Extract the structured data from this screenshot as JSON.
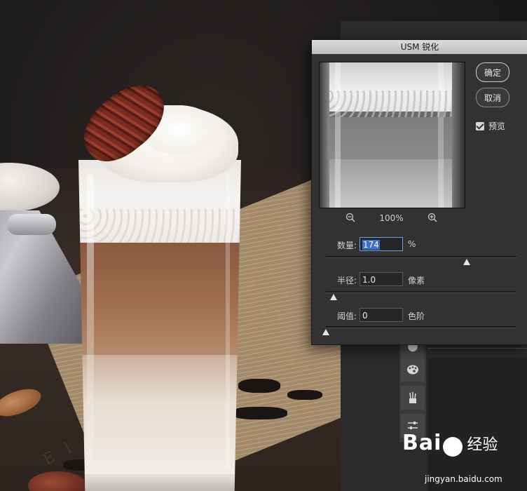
{
  "dialog": {
    "title": "USM 锐化",
    "ok_label": "确定",
    "cancel_label": "取消",
    "preview_label": "预览",
    "preview_checked": true,
    "zoom_level": "100%",
    "amount": {
      "label": "数量:",
      "value": "174",
      "unit": "%",
      "fraction": 0.74
    },
    "radius": {
      "label": "半径:",
      "value": "1.0",
      "unit": "像素",
      "fraction": 0.04
    },
    "threshold": {
      "label": "阈值:",
      "value": "0",
      "unit": "色阶",
      "fraction": 0.0
    }
  },
  "toolbar": {
    "icons": [
      "palette-icon",
      "brushes-icon",
      "sliders-icon"
    ]
  },
  "watermark": {
    "logo": "Bai",
    "logo_suffix": "经验",
    "url": "jingyan.baidu.com"
  }
}
